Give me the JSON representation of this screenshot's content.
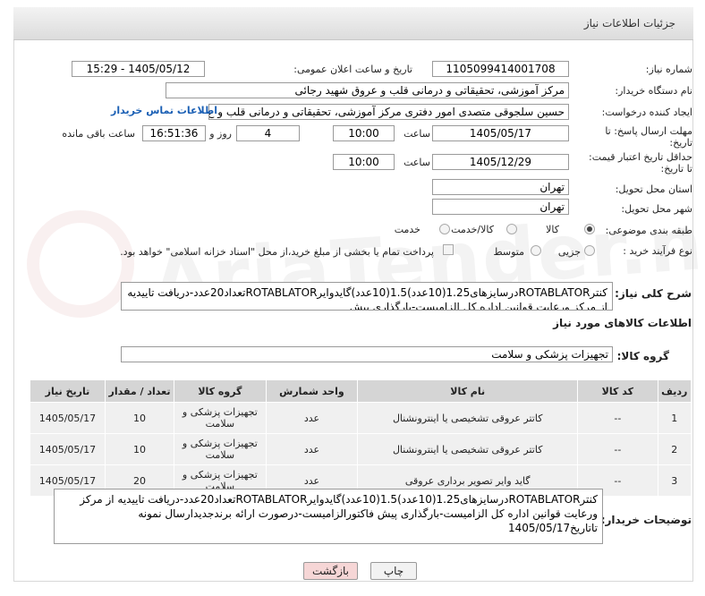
{
  "header": {
    "title": "جزئیات اطلاعات نیاز"
  },
  "fields": {
    "need_number_label": "شماره نیاز:",
    "need_number": "1105099414001708",
    "announce_label": "تاریخ و ساعت اعلان عمومی:",
    "announce_value": "1405/05/12 - 15:29",
    "buyer_label": "نام دستگاه خریدار:",
    "buyer_value": "مرکز آموزشی، تحقیقاتی و درمانی قلب و عروق شهید رجائی",
    "creator_label": "ایجاد کننده درخواست:",
    "creator_value": "حسین سلجوقی متصدی امور دفتری مرکز آموزشی، تحقیقاتی و درمانی قلب و ع",
    "contact_link": "اطلاعات تماس خریدار",
    "deadline_label_1": "مهلت ارسال پاسخ: تا",
    "deadline_label_2": "تاریخ:",
    "deadline_date": "1405/05/17",
    "time_label": "ساعت",
    "deadline_time": "10:00",
    "days_value": "4",
    "days_label": "روز و",
    "remaining_time": "16:51:36",
    "remaining_label": "ساعت باقی مانده",
    "validity_label_1": "حداقل تاریخ اعتبار قیمت:",
    "validity_label_2": "تا تاریخ:",
    "validity_date": "1405/12/29",
    "validity_time": "10:00",
    "province_label": "استان محل تحویل:",
    "province_value": "تهران",
    "city_label": "شهر محل تحویل:",
    "city_value": "تهران",
    "category_label": "طبقه بندی موضوعی:",
    "category_options": [
      "کالا",
      "کالا/خدمت",
      "خدمت"
    ],
    "process_label": "نوع فرآیند خرید :",
    "process_options": [
      "جزیی",
      "متوسط"
    ],
    "payment_text": "پرداخت تمام یا بخشی از مبلغ خرید،از محل \"اسناد خزانه اسلامی\" خواهد بود."
  },
  "description": {
    "label": "شرح کلی نیاز:",
    "text": "کنترROTABLATORدرسایزهای1.25(10عدد)1.5(10عدد)گایدوایرROTABLATORتعداد20عدد-دریافت تاییدیه از مرکز ورعایت قوانین اداره کل الزامیست-بارگذاری پیش"
  },
  "goods": {
    "section_title": "اطلاعات کالاهای مورد نیاز",
    "group_label": "گروه کالا:",
    "group_value": "تجهیزات پزشکی و سلامت"
  },
  "table": {
    "headers": [
      "ردیف",
      "کد کالا",
      "نام کالا",
      "واحد شمارش",
      "گروه کالا",
      "تعداد / مقدار",
      "تاریخ نیاز"
    ],
    "rows": [
      [
        "1",
        "--",
        "کاتتر عروقی تشخیصی یا اینترونشنال",
        "عدد",
        "تجهیزات پزشکی و سلامت",
        "10",
        "1405/05/17"
      ],
      [
        "2",
        "--",
        "کاتتر عروقی تشخیصی یا اینترونشنال",
        "عدد",
        "تجهیزات پزشکی و سلامت",
        "10",
        "1405/05/17"
      ],
      [
        "3",
        "--",
        "گاید وایر تصویر برداری عروقی",
        "عدد",
        "تجهیزات پزشکی و سلامت",
        "20",
        "1405/05/17"
      ]
    ]
  },
  "buyer_notes": {
    "label": "توضیحات خریدار:",
    "text": "کنترROTABLATORدرسایزهای1.25(10عدد)1.5(10عدد)گایدوایرROTABLATORتعداد20عدد-دریافت تاییدیه از مرکز ورعایت قوانین اداره کل الزامیست-بارگذاری پیش فاکتورالزامیست-درصورت ارائه برندجدیدارسال نمونه تاتاریخ1405/05/17"
  },
  "buttons": {
    "print": "چاپ",
    "back": "بازگشت"
  },
  "watermark": "AriaTender.net",
  "colors": {
    "back_button": "#f6d6d6",
    "link": "#1a5fb4",
    "header": "#e3e3e3"
  }
}
